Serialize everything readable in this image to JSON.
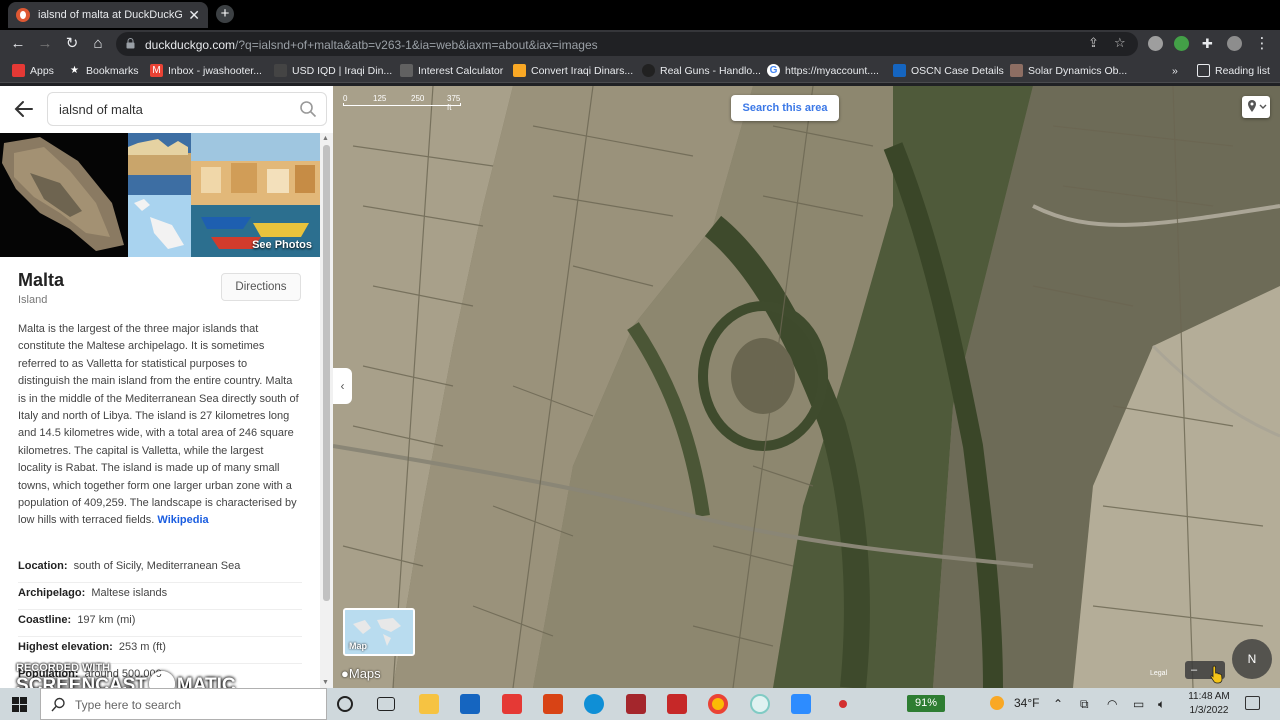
{
  "browser": {
    "tab_title": "ialsnd of malta at DuckDuckGo",
    "url_host": "duckduckgo.com",
    "url_path": "/?q=ialsnd+of+malta&atb=v263-1&ia=web&iaxm=about&iax=images"
  },
  "bookmarks": [
    {
      "label": "Apps",
      "color": "#e53935"
    },
    {
      "label": "Bookmarks",
      "color": "#fbc02d"
    },
    {
      "label": "Inbox - jwashooter...",
      "color": "#ea4335"
    },
    {
      "label": "USD IQD | Iraqi Din...",
      "color": "#444444"
    },
    {
      "label": "Interest Calculator",
      "color": "#616161"
    },
    {
      "label": "Convert Iraqi Dinars...",
      "color": "#f9a825"
    },
    {
      "label": "Real Guns - Handlo...",
      "color": "#212121"
    },
    {
      "label": "https://myaccount....",
      "color": "#4285f4"
    },
    {
      "label": "OSCN Case Details",
      "color": "#1565c0"
    },
    {
      "label": "Solar Dynamics Ob...",
      "color": "#8d6e63"
    }
  ],
  "bookmarks_more": "»",
  "reading_list": "Reading list",
  "search": {
    "query": "ialsnd of malta"
  },
  "photos": {
    "see_photos": "See Photos"
  },
  "knowledge": {
    "title": "Malta",
    "subtitle": "Island",
    "directions": "Directions",
    "description": "Malta is the largest of the three major islands that constitute the Maltese archipelago. It is sometimes referred to as Valletta for statistical purposes to distinguish the main island from the entire country. Malta is in the middle of the Mediterranean Sea directly south of Italy and north of Libya. The island is 27 kilometres long and 14.5 kilometres wide, with a total area of 246 square kilometres. The capital is Valletta, while the largest locality is Rabat. The island is made up of many small towns, which together form one larger urban zone with a population of 409,259. The landscape is characterised by low hills with terraced fields.",
    "wiki_link": "Wikipedia",
    "facts": [
      {
        "label": "Location:",
        "value": "south of Sicily, Mediterranean Sea"
      },
      {
        "label": "Archipelago:",
        "value": "Maltese islands"
      },
      {
        "label": "Coastline:",
        "value": "197 km (mi)"
      },
      {
        "label": "Highest elevation:",
        "value": "253 m (ft)"
      },
      {
        "label": "Population:",
        "value": "around 500,000"
      }
    ]
  },
  "map": {
    "scale_labels": [
      "0",
      "125",
      "250",
      "375 ft"
    ],
    "search_area": "Search this area",
    "map_thumb_label": "Map",
    "apple_maps": "Maps",
    "legal": "Legal",
    "compass": "N",
    "zoom_minus": "–"
  },
  "watermark": {
    "recorded_with": "RECORDED WITH",
    "brand_left": "SCREENCAST",
    "brand_right": "MATIC"
  },
  "taskbar": {
    "search_placeholder": "Type here to search",
    "battery": "91%",
    "weather": "34°F",
    "time": "11:48 AM",
    "date": "1/3/2022"
  }
}
